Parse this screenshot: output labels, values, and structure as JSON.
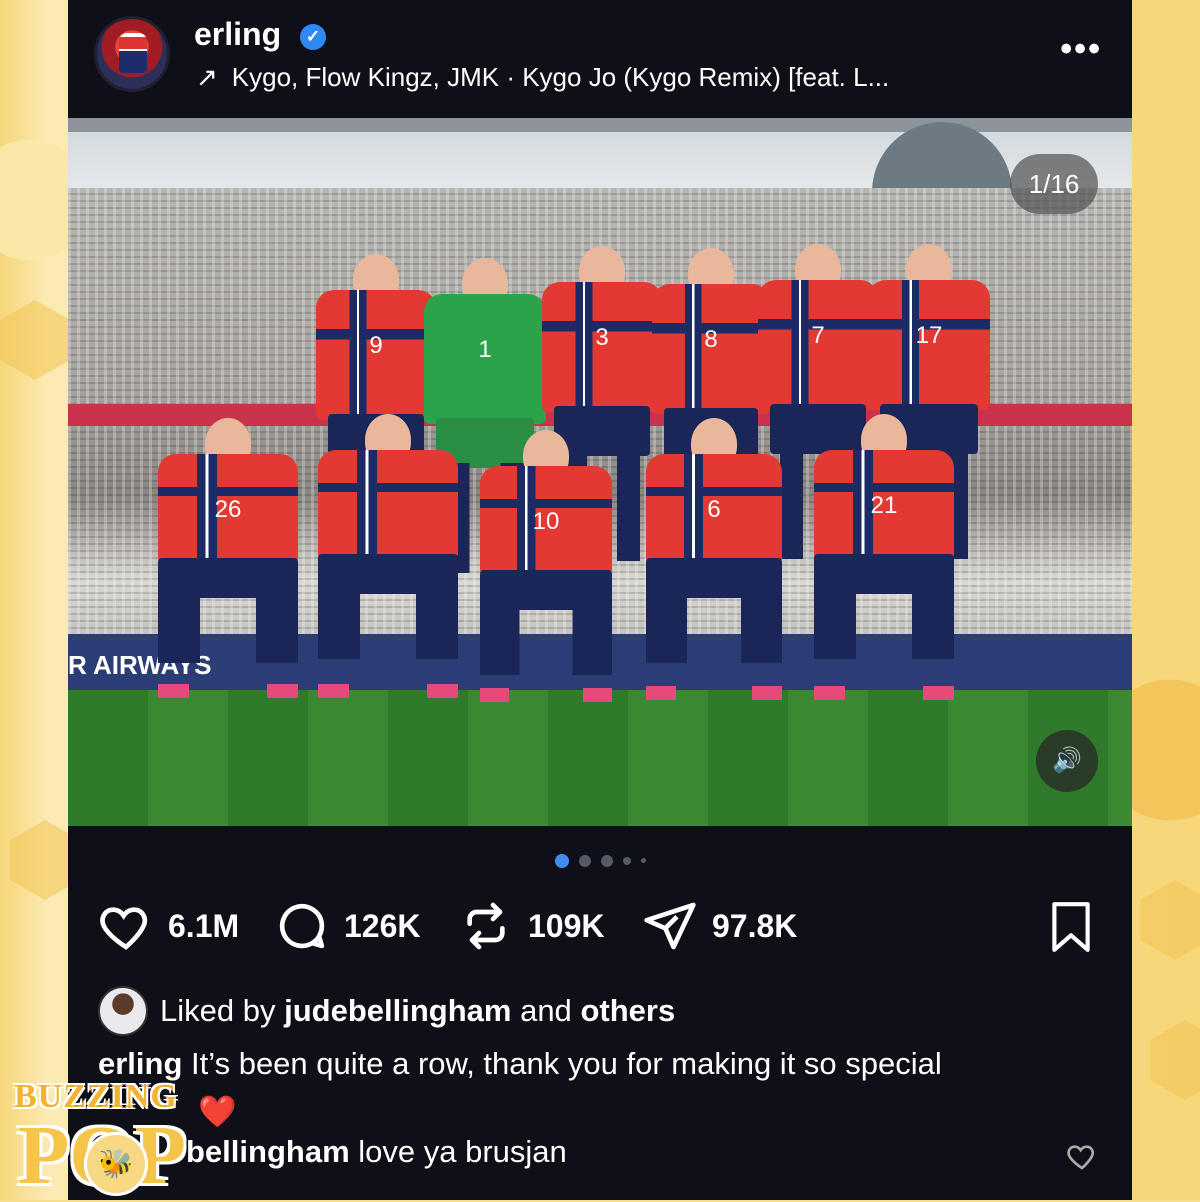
{
  "post": {
    "username": "erling",
    "music": "Kygo, Flow Kingz, JMK · Kygo Jo (Kygo Remix) [feat. L...",
    "more_label": "•••",
    "media_counter": "1/16",
    "team_photo_numbers": [
      "9",
      "1",
      "3",
      "8",
      "7",
      "17",
      "26",
      "10",
      "6",
      "21"
    ],
    "ad_text": "R AIRWAYS"
  },
  "stats": {
    "likes": "6.1M",
    "comments": "126K",
    "reposts": "109K",
    "shares": "97.8K"
  },
  "liked_by": {
    "prefix": "Liked by",
    "user": "judebellingham",
    "connector": "and",
    "others": "others"
  },
  "caption": {
    "user": "erling",
    "text": "It’s been quite a row, thank you for making it so special",
    "emoji": "❤️"
  },
  "comment": {
    "user": "bellingham",
    "text": "love ya brusjan"
  },
  "watermark": {
    "line1": "BUZZING",
    "line2": "POP"
  },
  "colors": {
    "background": "#0e0f17",
    "verified": "#2f8af5",
    "active_dot": "#3f8cf2",
    "frame": "#f6dc8c"
  }
}
